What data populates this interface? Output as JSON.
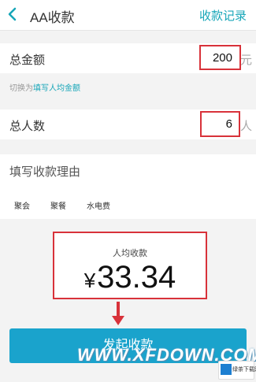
{
  "header": {
    "title": "AA收款",
    "action_label": "收款记录"
  },
  "total_amount": {
    "label": "总金额",
    "value": "200",
    "unit": "元"
  },
  "switch": {
    "prefix": "切换为",
    "link_label": "填写人均金额"
  },
  "people": {
    "label": "总人数",
    "value": "6",
    "unit": "人"
  },
  "reason": {
    "label": "填写收款理由",
    "chips": [
      "聚会",
      "聚餐",
      "水电费"
    ]
  },
  "per_person": {
    "label": "人均收款",
    "currency": "¥",
    "amount": "33.34"
  },
  "submit": {
    "label": "发起收款"
  },
  "watermark": {
    "text": "WWW.XFDOWN.COM",
    "badge_text": "绿茶下载网"
  },
  "colors": {
    "accent": "#17a6b8",
    "button": "#1aa3cc",
    "highlight_border": "#d8323a"
  }
}
